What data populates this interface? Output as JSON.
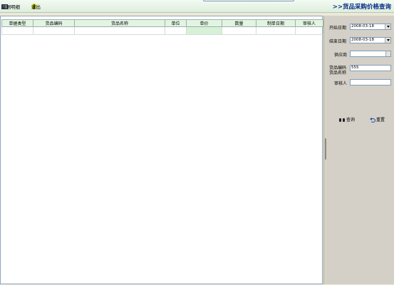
{
  "toolbar": {
    "detail_label": "单据明细",
    "exit_label": "退出"
  },
  "page_title": ">>货品采购价格查询",
  "table": {
    "columns": [
      "单据类型",
      "货品编码",
      "货品名称",
      "单位",
      "单价",
      "数量",
      "制单日期",
      "审核人"
    ],
    "rows": [
      [
        "",
        "",
        "",
        "",
        "",
        "",
        "",
        ""
      ]
    ]
  },
  "search": {
    "start_date_label": "开始日期",
    "start_date_value": "2008-03-18",
    "end_date_label": "结束日期",
    "end_date_value": "2008-03-18",
    "supplier_label": "供应商",
    "supplier_value": "",
    "goods_code_label": "货品编码",
    "goods_code_value": "555",
    "goods_name_label": "货品名称",
    "reviewer_label": "审核人",
    "reviewer_value": "",
    "query_label": "查询",
    "reset_label": "重置"
  },
  "colors": {
    "header_bg": "#e2f4e4",
    "title_color": "#0a2a88",
    "side_bg": "#d4d0c8",
    "selected_cell": "#d7f1d9"
  },
  "icons": [
    "grid-icon",
    "exit-icon",
    "binoculars-icon",
    "reset-icon",
    "dropdown-arrow-icon"
  ]
}
